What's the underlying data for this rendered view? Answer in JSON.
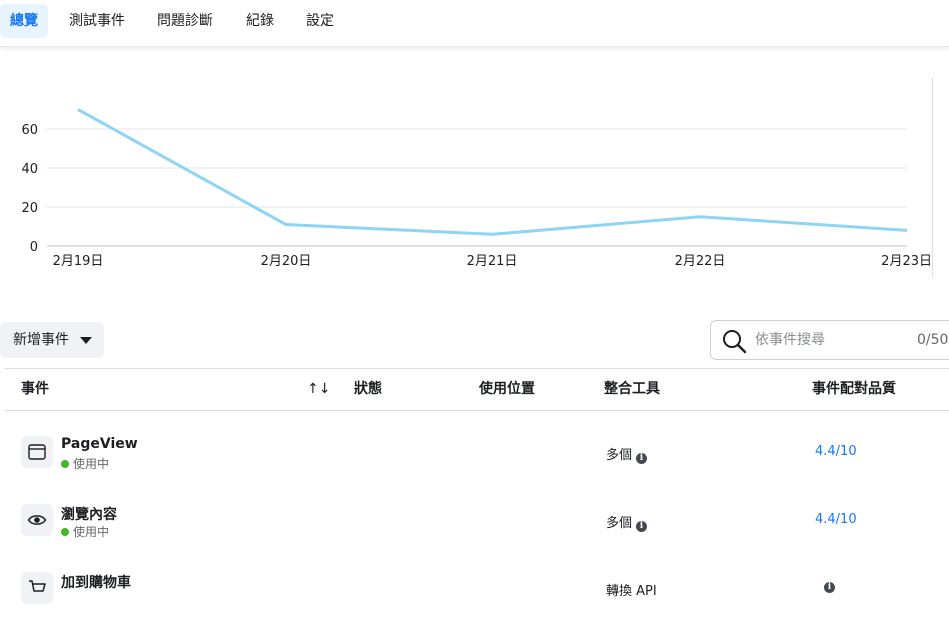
{
  "tabs": [
    {
      "label": "總覽",
      "active": true
    },
    {
      "label": "測試事件"
    },
    {
      "label": "問題診斷"
    },
    {
      "label": "紀錄"
    },
    {
      "label": "設定"
    }
  ],
  "chart_data": {
    "type": "line",
    "categories": [
      "2月19日",
      "2月20日",
      "2月21日",
      "2月22日",
      "2月23日"
    ],
    "series": [
      {
        "values": [
          70,
          11,
          6,
          15,
          8
        ],
        "color": "#8fd3f5"
      }
    ],
    "yticks": [
      0,
      20,
      40,
      60
    ],
    "ylim": [
      0,
      60
    ],
    "grid": true
  },
  "toolbar": {
    "add_event_label": "新增事件",
    "search_placeholder": "依事件搜尋",
    "search_count": "0/50"
  },
  "table": {
    "headers": {
      "event": "事件",
      "sort_icon": "↑↓",
      "status": "狀態",
      "usage": "使用位置",
      "integration": "整合工具",
      "match_quality": "事件配對品質"
    },
    "rows": [
      {
        "name": "PageView",
        "status": "使用中",
        "integration": "多個",
        "quality": "4.4/10",
        "icon": "browser-window-icon"
      },
      {
        "name": "瀏覽內容",
        "status": "使用中",
        "integration": "多個",
        "quality": "4.4/10",
        "icon": "eye-icon"
      },
      {
        "name": "加到購物車",
        "status": "",
        "integration": "轉換 API",
        "quality": "",
        "icon": "cart-icon"
      }
    ]
  },
  "colors": {
    "accent": "#1877f2",
    "active_green": "#42b72a",
    "chart_line": "#8fd3f5"
  }
}
